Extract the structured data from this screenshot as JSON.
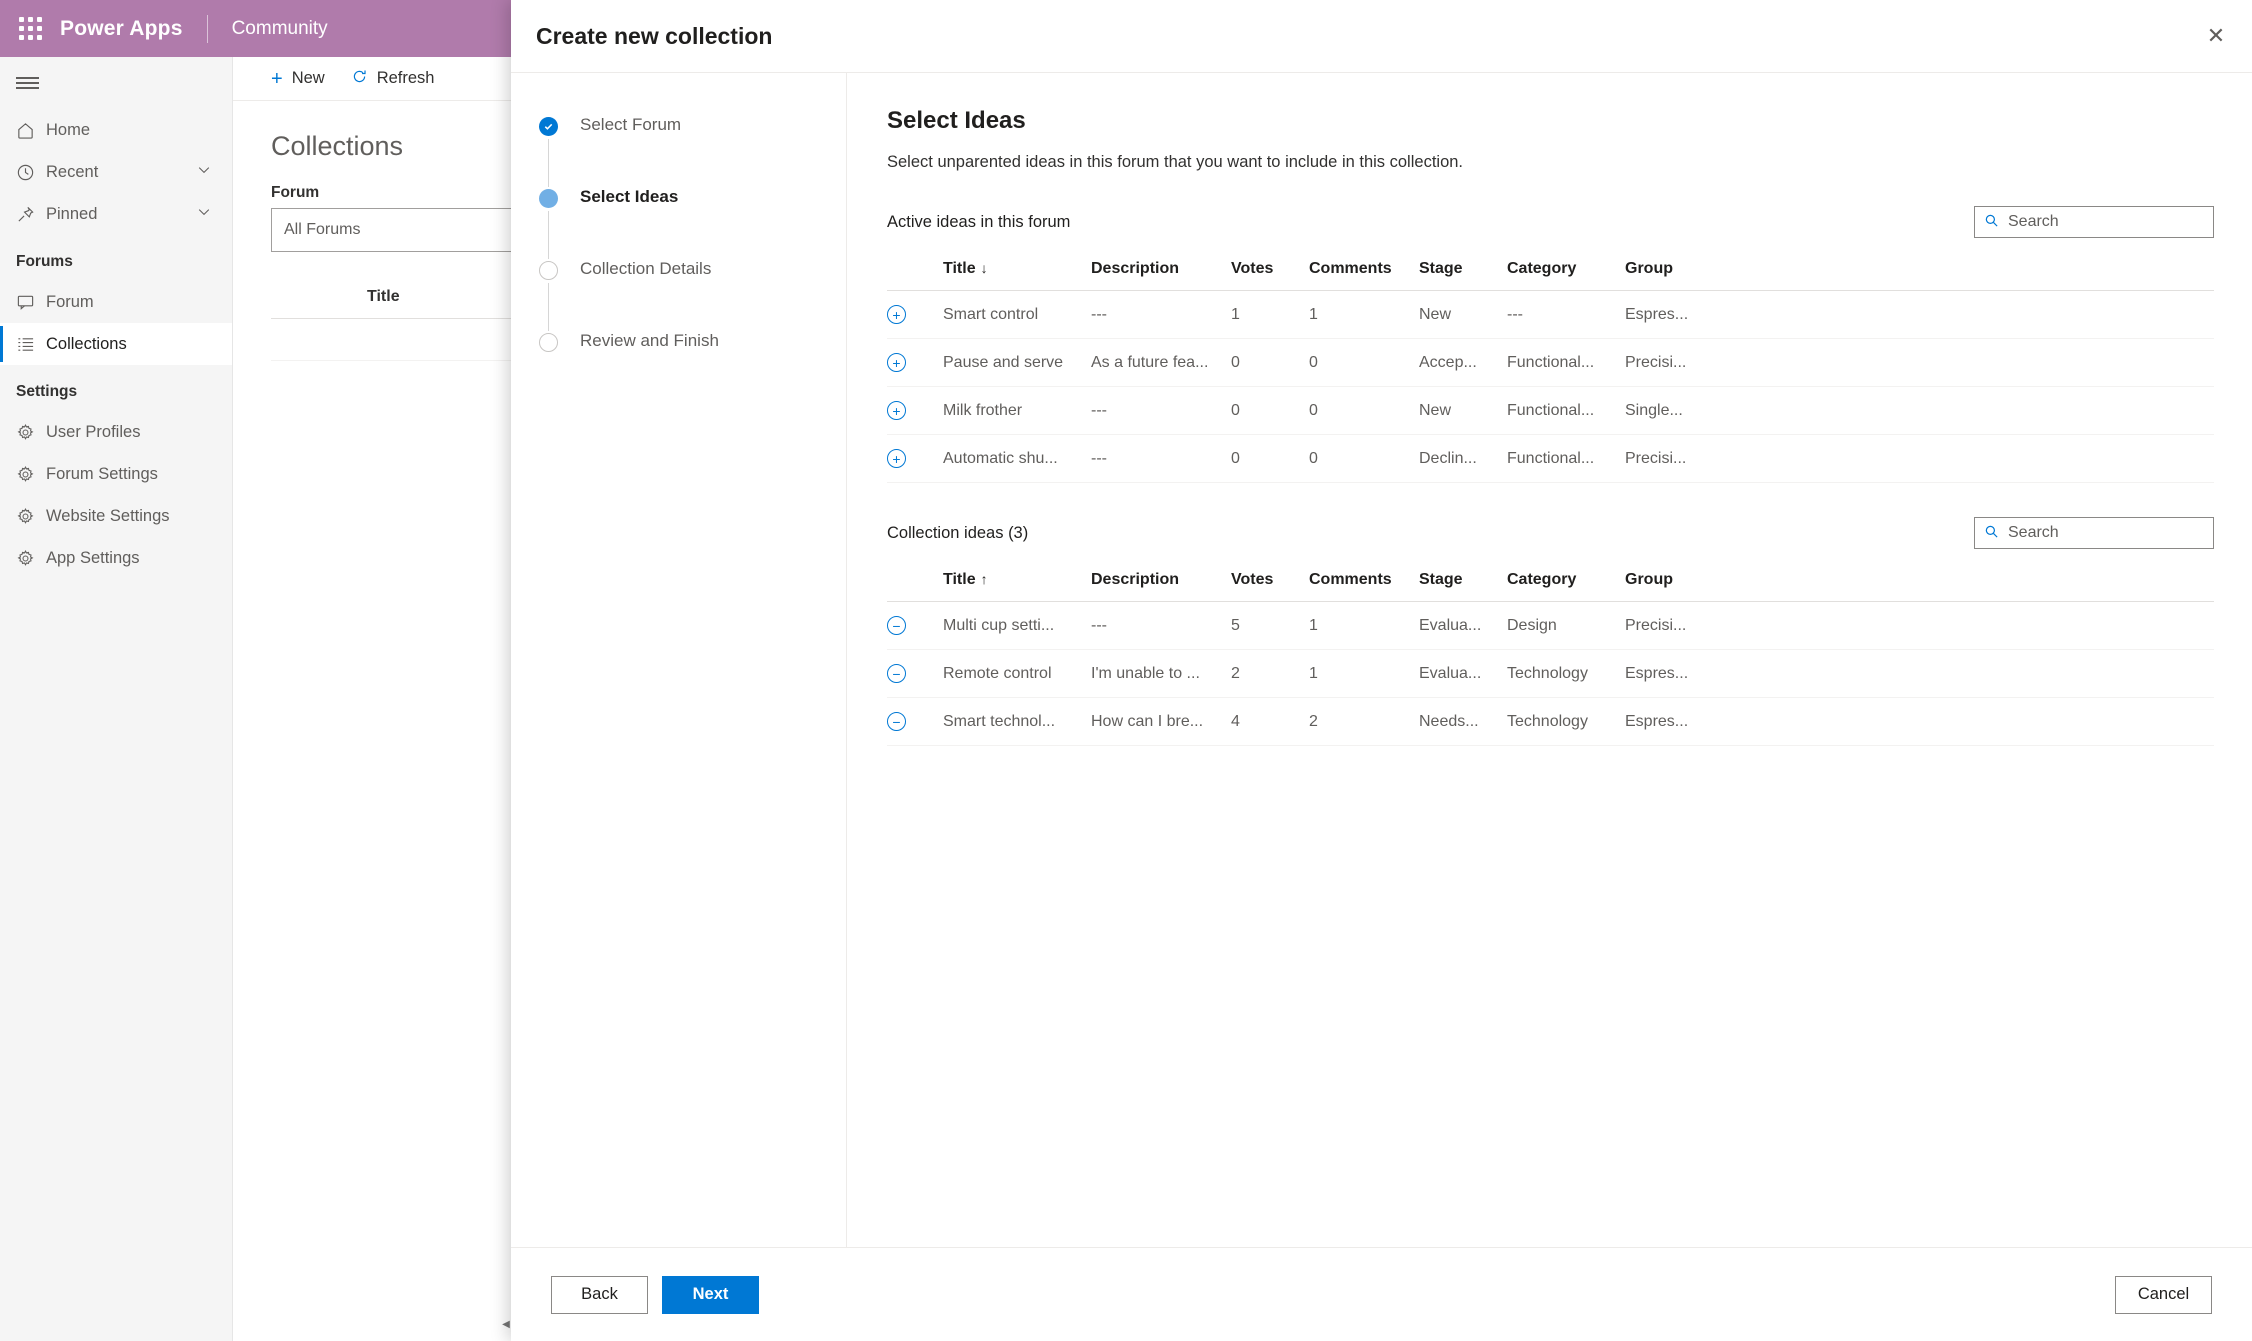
{
  "topbar": {
    "waffle_icon": "app-launcher-icon",
    "brand": "Power Apps",
    "sub_brand": "Community"
  },
  "sidebar": {
    "hamburger_icon": "hamburger-icon",
    "items": [
      {
        "label": "Home",
        "icon": "home-icon",
        "expandable": false,
        "active": false
      },
      {
        "label": "Recent",
        "icon": "clock-icon",
        "expandable": true,
        "active": false
      },
      {
        "label": "Pinned",
        "icon": "pin-icon",
        "expandable": true,
        "active": false
      }
    ],
    "groups": [
      {
        "label": "Forums",
        "items": [
          {
            "label": "Forum",
            "icon": "forum-icon",
            "active": false
          },
          {
            "label": "Collections",
            "icon": "collections-icon",
            "active": true
          }
        ]
      },
      {
        "label": "Settings",
        "items": [
          {
            "label": "User Profiles",
            "icon": "gear-icon",
            "active": false
          },
          {
            "label": "Forum Settings",
            "icon": "gear-icon",
            "active": false
          },
          {
            "label": "Website Settings",
            "icon": "gear-icon",
            "active": false
          },
          {
            "label": "App Settings",
            "icon": "gear-icon",
            "active": false
          }
        ]
      }
    ]
  },
  "content": {
    "commands": [
      {
        "label": "New",
        "icon": "plus-icon"
      },
      {
        "label": "Refresh",
        "icon": "refresh-icon"
      }
    ],
    "page_title": "Collections",
    "forum_label": "Forum",
    "forum_value": "All Forums",
    "grid_column": "Title"
  },
  "modal": {
    "title": "Create new collection",
    "close_icon": "close-icon",
    "steps": [
      {
        "label": "Select Forum",
        "state": "done"
      },
      {
        "label": "Select Ideas",
        "state": "current"
      },
      {
        "label": "Collection Details",
        "state": "todo"
      },
      {
        "label": "Review and Finish",
        "state": "todo"
      }
    ],
    "panel": {
      "title": "Select Ideas",
      "subtitle": "Select unparented ideas in this forum that you want to include in this collection."
    },
    "active_section": {
      "label": "Active ideas in this forum",
      "search_placeholder": "Search",
      "search_icon": "search-icon",
      "columns": [
        "",
        "Title",
        "Description",
        "Votes",
        "Comments",
        "Stage",
        "Category",
        "Group"
      ],
      "sort_column": "Title",
      "sort_direction": "↓",
      "rows": [
        {
          "action_icon": "add-icon",
          "action_glyph": "+",
          "title": "Smart control",
          "description": "---",
          "votes": "1",
          "comments": "1",
          "stage": "New",
          "category": "---",
          "group": "Espres..."
        },
        {
          "action_icon": "add-icon",
          "action_glyph": "+",
          "title": "Pause and serve",
          "description": "As a future fea...",
          "votes": "0",
          "comments": "0",
          "stage": "Accep...",
          "category": "Functional...",
          "group": "Precisi..."
        },
        {
          "action_icon": "add-icon",
          "action_glyph": "+",
          "title": "Milk frother",
          "description": "---",
          "votes": "0",
          "comments": "0",
          "stage": "New",
          "category": "Functional...",
          "group": "Single..."
        },
        {
          "action_icon": "add-icon",
          "action_glyph": "+",
          "title": "Automatic shu...",
          "description": "---",
          "votes": "0",
          "comments": "0",
          "stage": "Declin...",
          "category": "Functional...",
          "group": "Precisi..."
        }
      ]
    },
    "collection_section": {
      "label": "Collection ideas (3)",
      "search_placeholder": "Search",
      "search_icon": "search-icon",
      "columns": [
        "",
        "Title",
        "Description",
        "Votes",
        "Comments",
        "Stage",
        "Category",
        "Group"
      ],
      "sort_column": "Title",
      "sort_direction": "↑",
      "rows": [
        {
          "action_icon": "remove-icon",
          "action_glyph": "−",
          "title": "Multi cup setti...",
          "description": "---",
          "votes": "5",
          "comments": "1",
          "stage": "Evalua...",
          "category": "Design",
          "group": "Precisi..."
        },
        {
          "action_icon": "remove-icon",
          "action_glyph": "−",
          "title": "Remote control",
          "description": "I'm unable to ...",
          "votes": "2",
          "comments": "1",
          "stage": "Evalua...",
          "category": "Technology",
          "group": "Espres..."
        },
        {
          "action_icon": "remove-icon",
          "action_glyph": "−",
          "title": "Smart technol...",
          "description": "How can I bre...",
          "votes": "4",
          "comments": "2",
          "stage": "Needs...",
          "category": "Technology",
          "group": "Espres..."
        }
      ]
    },
    "footer": {
      "back_label": "Back",
      "next_label": "Next",
      "cancel_label": "Cancel"
    }
  },
  "colors": {
    "brand_bar": "#b07bab",
    "accent": "#0078d4",
    "step_current": "#71afe5",
    "sidebar_bg": "#f5f5f5"
  }
}
